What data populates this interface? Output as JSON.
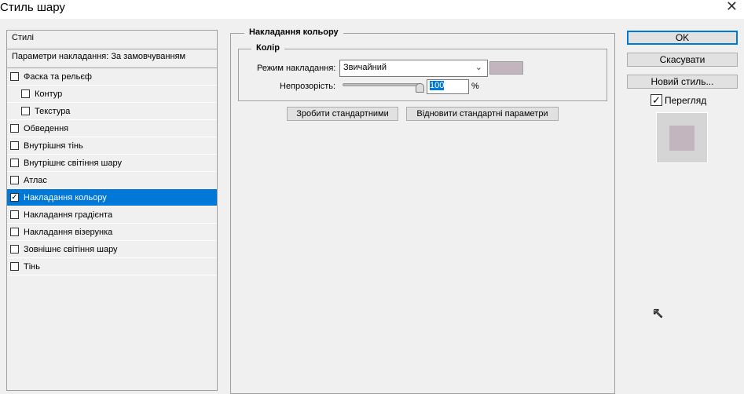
{
  "window": {
    "title": "Стиль шару",
    "close": "✕"
  },
  "styles_panel": {
    "header": "Стилі",
    "blending": "Параметри накладання: За замовчуванням",
    "items": [
      {
        "label": "Фаска та рельєф",
        "checked": false,
        "sub": false
      },
      {
        "label": "Контур",
        "checked": false,
        "sub": true
      },
      {
        "label": "Текстура",
        "checked": false,
        "sub": true
      },
      {
        "label": "Обведення",
        "checked": false,
        "sub": false
      },
      {
        "label": "Внутрішня тінь",
        "checked": false,
        "sub": false
      },
      {
        "label": "Внутрішнє світіння шару",
        "checked": false,
        "sub": false
      },
      {
        "label": "Атлас",
        "checked": false,
        "sub": false
      },
      {
        "label": "Накладання кольору",
        "checked": true,
        "sub": false,
        "selected": true
      },
      {
        "label": "Накладання градієнта",
        "checked": false,
        "sub": false
      },
      {
        "label": "Накладання візерунка",
        "checked": false,
        "sub": false
      },
      {
        "label": "Зовнішнє світіння шару",
        "checked": false,
        "sub": false
      },
      {
        "label": "Тінь",
        "checked": false,
        "sub": false
      }
    ]
  },
  "color_overlay": {
    "title": "Накладання кольору",
    "group": "Колір",
    "blend_mode_label": "Режим накладання:",
    "blend_mode_value": "Звичайний",
    "color": "#c2b5be",
    "opacity_label": "Непрозорість:",
    "opacity_value": "100",
    "opacity_unit": "%",
    "make_default": "Зробити стандартними",
    "reset_default": "Відновити стандартні параметри"
  },
  "buttons": {
    "ok": "OK",
    "cancel": "Скасувати",
    "new_style": "Новий стиль...",
    "preview_label": "Перегляд",
    "preview_checked": true
  }
}
